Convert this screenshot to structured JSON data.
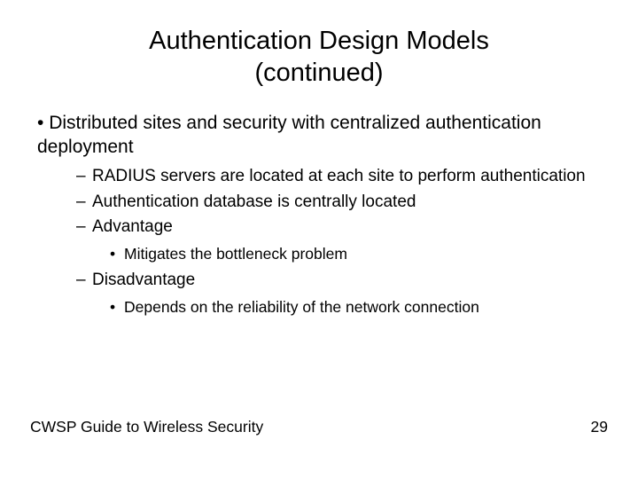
{
  "title_line1": "Authentication Design Models",
  "title_line2": "(continued)",
  "bullet1": "Distributed sites and security with centralized authentication deployment",
  "sub1": "RADIUS servers are located at each site to perform authentication",
  "sub2": "Authentication database is centrally located",
  "sub3": "Advantage",
  "sub3_detail": "Mitigates the bottleneck problem",
  "sub4": "Disadvantage",
  "sub4_detail": "Depends on the reliability of the network connection",
  "footer_left": "CWSP Guide to Wireless Security",
  "footer_right": "29"
}
